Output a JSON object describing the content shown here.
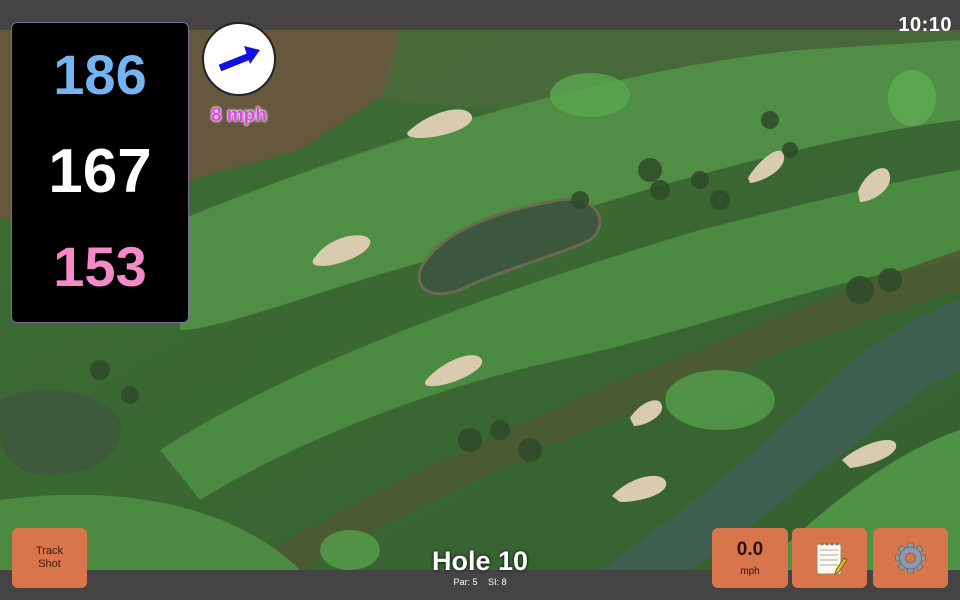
{
  "clock": "10:10",
  "yardages": {
    "back": "186",
    "middle": "167",
    "front": "153"
  },
  "wind": {
    "speed": "8 mph",
    "icon": "wind-direction-arrow-icon",
    "color": "#e043e6"
  },
  "buttons": {
    "track_shot": {
      "line1": "Track",
      "line2": "Shot"
    },
    "speed": {
      "value": "0.0",
      "unit": "mph"
    },
    "notes_icon": "notepad-icon",
    "settings_icon": "gear-icon"
  },
  "hole": {
    "title": "Hole 10",
    "par": "Par: 5",
    "si": "SI: 8"
  },
  "colors": {
    "back": "#74b4f2",
    "middle": "#ffffff",
    "front": "#f58ac8",
    "button": "#d9754a"
  }
}
